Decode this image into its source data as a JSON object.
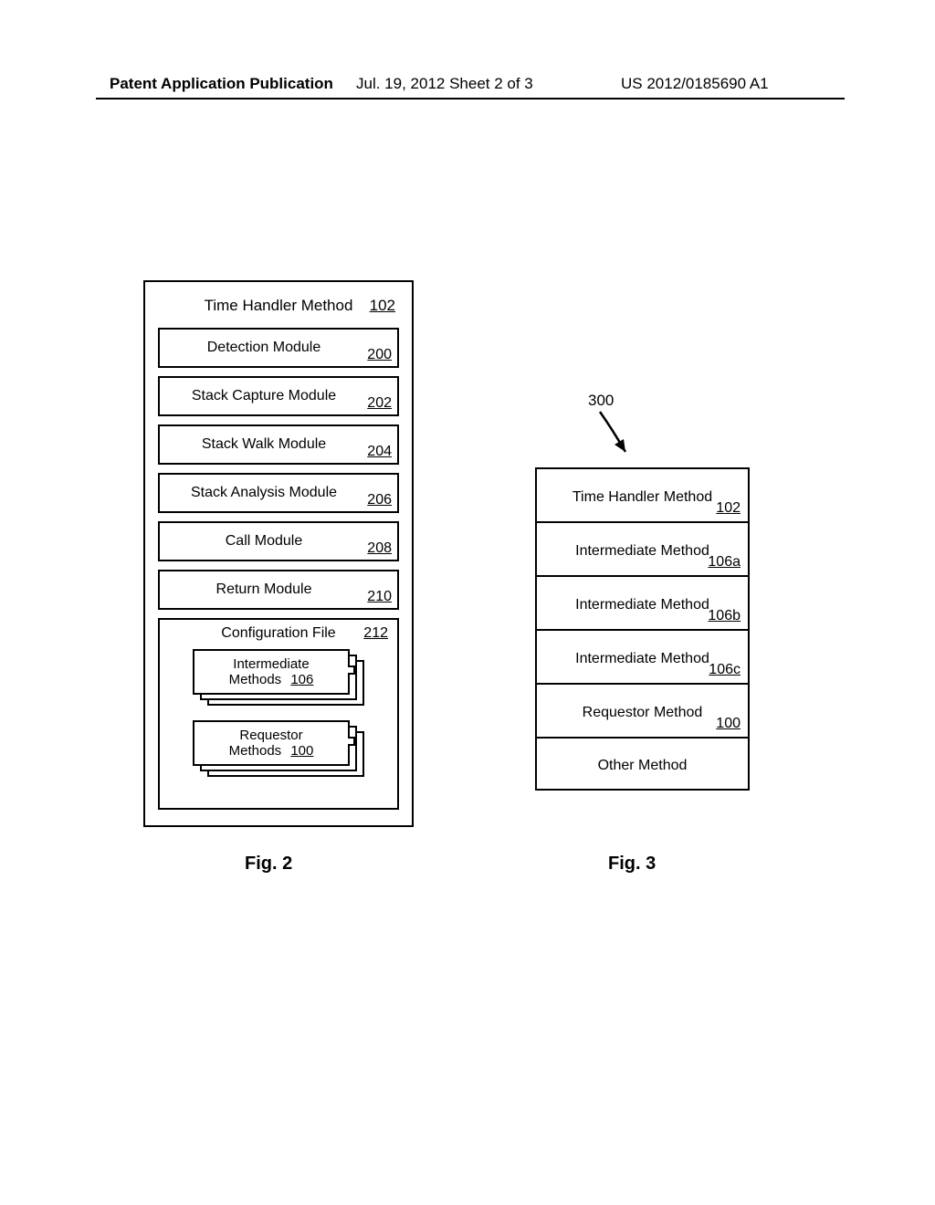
{
  "header": {
    "left": "Patent Application Publication",
    "center": "Jul. 19, 2012  Sheet 2 of 3",
    "right": "US 2012/0185690 A1"
  },
  "fig2": {
    "title": "Time Handler Method",
    "title_ref": "102",
    "modules": [
      {
        "label": "Detection Module",
        "ref": "200"
      },
      {
        "label": "Stack Capture Module",
        "ref": "202"
      },
      {
        "label": "Stack Walk Module",
        "ref": "204"
      },
      {
        "label": "Stack Analysis Module",
        "ref": "206"
      },
      {
        "label": "Call Module",
        "ref": "208"
      },
      {
        "label": "Return Module",
        "ref": "210"
      }
    ],
    "config": {
      "title": "Configuration File",
      "ref": "212",
      "stacks": [
        {
          "line1": "Intermediate",
          "line2": "Methods",
          "ref": "106"
        },
        {
          "line1": "Requestor",
          "line2": "Methods",
          "ref": "100"
        }
      ]
    },
    "caption": "Fig. 2"
  },
  "fig3": {
    "pointer": "300",
    "rows": [
      {
        "label": "Time Handler Method",
        "ref": "102"
      },
      {
        "label": "Intermediate Method",
        "ref": "106a"
      },
      {
        "label": "Intermediate Method",
        "ref": "106b"
      },
      {
        "label": "Intermediate Method",
        "ref": "106c"
      },
      {
        "label": "Requestor Method",
        "ref": "100"
      },
      {
        "label": "Other Method",
        "ref": ""
      }
    ],
    "caption": "Fig. 3"
  }
}
